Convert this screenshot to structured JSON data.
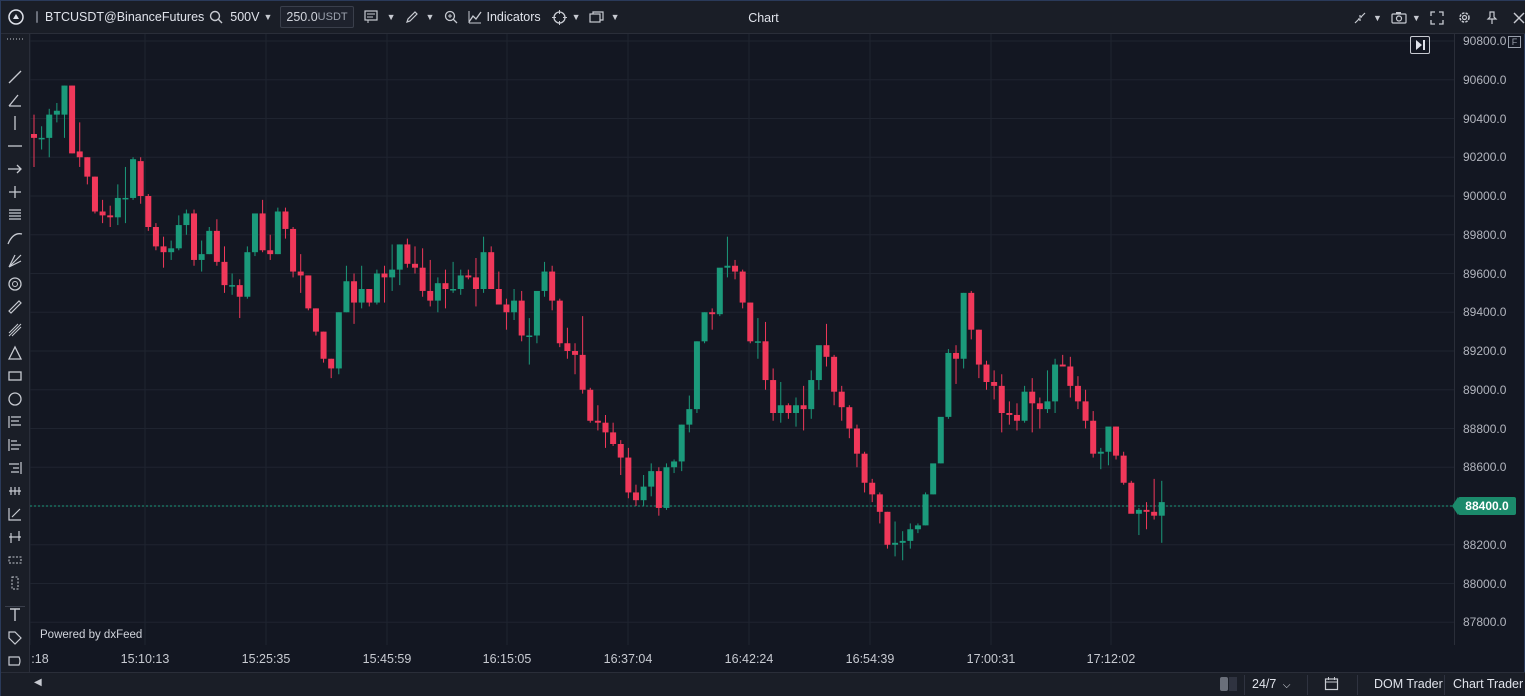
{
  "toolbar": {
    "symbol": "BTCUSDT@BinanceFutures",
    "timeframe": "500V",
    "quantity_value": "250.0",
    "quantity_unit": "USDT",
    "indicators_label": "Indicators"
  },
  "window": {
    "title": "Chart"
  },
  "price_axis": {
    "labels": [
      "90800.0",
      "90600.0",
      "90400.0",
      "90200.0",
      "90000.0",
      "89800.0",
      "89600.0",
      "89400.0",
      "89200.0",
      "89000.0",
      "88800.0",
      "88600.0",
      "88400.0",
      "88200.0",
      "88000.0",
      "87800.0"
    ],
    "current_price": "88400.0",
    "f_badge": "F"
  },
  "time_axis": {
    "labels": [
      ":18",
      "15:10:13",
      "15:25:35",
      "15:45:59",
      "16:15:05",
      "16:37:04",
      "16:42:24",
      "16:54:39",
      "17:00:31",
      "17:12:02"
    ]
  },
  "watermark": "Powered by dxFeed",
  "bottom": {
    "session": "24/7",
    "dom_trader": "DOM Trader",
    "chart_trader": "Chart Trader"
  },
  "colors": {
    "up": "#1b9a7b",
    "down": "#f0385a",
    "background": "#131722",
    "grid": "#1f2430"
  },
  "chart_data": {
    "type": "candlestick",
    "title": "",
    "ylim": [
      87700,
      90850
    ],
    "current_price": 88400,
    "x_tick_labels": [
      ":18",
      "15:10:13",
      "15:25:35",
      "15:45:59",
      "16:15:05",
      "16:37:04",
      "16:42:24",
      "16:54:39",
      "17:00:31",
      "17:12:02"
    ],
    "candles": [
      {
        "o": 90320,
        "h": 90420,
        "l": 90150,
        "c": 90300
      },
      {
        "o": 90300,
        "h": 90360,
        "l": 90240,
        "c": 90300
      },
      {
        "o": 90300,
        "h": 90450,
        "l": 90200,
        "c": 90420
      },
      {
        "o": 90420,
        "h": 90480,
        "l": 90380,
        "c": 90440
      },
      {
        "o": 90420,
        "h": 90570,
        "l": 90300,
        "c": 90570
      },
      {
        "o": 90570,
        "h": 90570,
        "l": 90220,
        "c": 90220
      },
      {
        "o": 90230,
        "h": 90380,
        "l": 90150,
        "c": 90200
      },
      {
        "o": 90200,
        "h": 90200,
        "l": 90060,
        "c": 90100
      },
      {
        "o": 90100,
        "h": 90100,
        "l": 89910,
        "c": 89920
      },
      {
        "o": 89920,
        "h": 89980,
        "l": 89860,
        "c": 89900
      },
      {
        "o": 89900,
        "h": 89950,
        "l": 89840,
        "c": 89890
      },
      {
        "o": 89890,
        "h": 90060,
        "l": 89850,
        "c": 89990
      },
      {
        "o": 89990,
        "h": 90150,
        "l": 89860,
        "c": 89990
      },
      {
        "o": 89990,
        "h": 90200,
        "l": 89980,
        "c": 90190
      },
      {
        "o": 90180,
        "h": 90200,
        "l": 89960,
        "c": 90000
      },
      {
        "o": 90000,
        "h": 90010,
        "l": 89820,
        "c": 89840
      },
      {
        "o": 89840,
        "h": 89860,
        "l": 89720,
        "c": 89740
      },
      {
        "o": 89740,
        "h": 89790,
        "l": 89630,
        "c": 89710
      },
      {
        "o": 89710,
        "h": 89770,
        "l": 89670,
        "c": 89730
      },
      {
        "o": 89730,
        "h": 89900,
        "l": 89720,
        "c": 89850
      },
      {
        "o": 89850,
        "h": 89930,
        "l": 89800,
        "c": 89910
      },
      {
        "o": 89910,
        "h": 89930,
        "l": 89640,
        "c": 89670
      },
      {
        "o": 89670,
        "h": 89770,
        "l": 89610,
        "c": 89700
      },
      {
        "o": 89700,
        "h": 89840,
        "l": 89700,
        "c": 89820
      },
      {
        "o": 89820,
        "h": 89880,
        "l": 89640,
        "c": 89660
      },
      {
        "o": 89660,
        "h": 89740,
        "l": 89500,
        "c": 89540
      },
      {
        "o": 89540,
        "h": 89600,
        "l": 89490,
        "c": 89540
      },
      {
        "o": 89540,
        "h": 89570,
        "l": 89370,
        "c": 89480
      },
      {
        "o": 89480,
        "h": 89740,
        "l": 89470,
        "c": 89710
      },
      {
        "o": 89710,
        "h": 89880,
        "l": 89690,
        "c": 89910
      },
      {
        "o": 89910,
        "h": 89980,
        "l": 89710,
        "c": 89720
      },
      {
        "o": 89720,
        "h": 89800,
        "l": 89670,
        "c": 89700
      },
      {
        "o": 89700,
        "h": 89940,
        "l": 89700,
        "c": 89920
      },
      {
        "o": 89920,
        "h": 89940,
        "l": 89780,
        "c": 89830
      },
      {
        "o": 89830,
        "h": 89840,
        "l": 89580,
        "c": 89610
      },
      {
        "o": 89610,
        "h": 89700,
        "l": 89500,
        "c": 89590
      },
      {
        "o": 89590,
        "h": 89590,
        "l": 89410,
        "c": 89420
      },
      {
        "o": 89420,
        "h": 89420,
        "l": 89280,
        "c": 89300
      },
      {
        "o": 89300,
        "h": 89300,
        "l": 89140,
        "c": 89160
      },
      {
        "o": 89160,
        "h": 89160,
        "l": 89060,
        "c": 89110
      },
      {
        "o": 89110,
        "h": 89400,
        "l": 89080,
        "c": 89400
      },
      {
        "o": 89400,
        "h": 89640,
        "l": 89400,
        "c": 89560
      },
      {
        "o": 89560,
        "h": 89600,
        "l": 89340,
        "c": 89450
      },
      {
        "o": 89450,
        "h": 89640,
        "l": 89420,
        "c": 89520
      },
      {
        "o": 89520,
        "h": 89520,
        "l": 89430,
        "c": 89450
      },
      {
        "o": 89450,
        "h": 89620,
        "l": 89440,
        "c": 89600
      },
      {
        "o": 89600,
        "h": 89640,
        "l": 89450,
        "c": 89580
      },
      {
        "o": 89580,
        "h": 89750,
        "l": 89510,
        "c": 89620
      },
      {
        "o": 89620,
        "h": 89750,
        "l": 89540,
        "c": 89750
      },
      {
        "o": 89750,
        "h": 89780,
        "l": 89630,
        "c": 89650
      },
      {
        "o": 89650,
        "h": 89740,
        "l": 89600,
        "c": 89630
      },
      {
        "o": 89630,
        "h": 89730,
        "l": 89480,
        "c": 89510
      },
      {
        "o": 89510,
        "h": 89670,
        "l": 89430,
        "c": 89460
      },
      {
        "o": 89460,
        "h": 89580,
        "l": 89400,
        "c": 89550
      },
      {
        "o": 89550,
        "h": 89620,
        "l": 89420,
        "c": 89520
      },
      {
        "o": 89520,
        "h": 89660,
        "l": 89500,
        "c": 89520
      },
      {
        "o": 89520,
        "h": 89620,
        "l": 89490,
        "c": 89590
      },
      {
        "o": 89590,
        "h": 89620,
        "l": 89570,
        "c": 89580
      },
      {
        "o": 89580,
        "h": 89680,
        "l": 89430,
        "c": 89520
      },
      {
        "o": 89520,
        "h": 89790,
        "l": 89500,
        "c": 89710
      },
      {
        "o": 89710,
        "h": 89740,
        "l": 89520,
        "c": 89520
      },
      {
        "o": 89520,
        "h": 89610,
        "l": 89440,
        "c": 89440
      },
      {
        "o": 89440,
        "h": 89470,
        "l": 89310,
        "c": 89400
      },
      {
        "o": 89400,
        "h": 89520,
        "l": 89360,
        "c": 89460
      },
      {
        "o": 89460,
        "h": 89510,
        "l": 89250,
        "c": 89280
      },
      {
        "o": 89280,
        "h": 89370,
        "l": 89130,
        "c": 89280
      },
      {
        "o": 89280,
        "h": 89430,
        "l": 89240,
        "c": 89510
      },
      {
        "o": 89510,
        "h": 89660,
        "l": 89480,
        "c": 89610
      },
      {
        "o": 89610,
        "h": 89640,
        "l": 89410,
        "c": 89460
      },
      {
        "o": 89460,
        "h": 89470,
        "l": 89220,
        "c": 89240
      },
      {
        "o": 89240,
        "h": 89320,
        "l": 89160,
        "c": 89200
      },
      {
        "o": 89200,
        "h": 89240,
        "l": 89080,
        "c": 89180
      },
      {
        "o": 89180,
        "h": 89380,
        "l": 88980,
        "c": 89000
      },
      {
        "o": 89000,
        "h": 89010,
        "l": 88830,
        "c": 88840
      },
      {
        "o": 88840,
        "h": 88920,
        "l": 88790,
        "c": 88830
      },
      {
        "o": 88830,
        "h": 88870,
        "l": 88700,
        "c": 88780
      },
      {
        "o": 88780,
        "h": 88830,
        "l": 88710,
        "c": 88720
      },
      {
        "o": 88720,
        "h": 88740,
        "l": 88560,
        "c": 88650
      },
      {
        "o": 88650,
        "h": 88700,
        "l": 88440,
        "c": 88470
      },
      {
        "o": 88470,
        "h": 88510,
        "l": 88400,
        "c": 88430
      },
      {
        "o": 88430,
        "h": 88560,
        "l": 88400,
        "c": 88500
      },
      {
        "o": 88500,
        "h": 88620,
        "l": 88450,
        "c": 88580
      },
      {
        "o": 88580,
        "h": 88600,
        "l": 88350,
        "c": 88390
      },
      {
        "o": 88390,
        "h": 88620,
        "l": 88380,
        "c": 88600
      },
      {
        "o": 88600,
        "h": 88640,
        "l": 88570,
        "c": 88630
      },
      {
        "o": 88630,
        "h": 88820,
        "l": 88580,
        "c": 88820
      },
      {
        "o": 88820,
        "h": 88970,
        "l": 88780,
        "c": 88900
      },
      {
        "o": 88900,
        "h": 89250,
        "l": 88880,
        "c": 89250
      },
      {
        "o": 89250,
        "h": 89400,
        "l": 89240,
        "c": 89400
      },
      {
        "o": 89400,
        "h": 89420,
        "l": 89310,
        "c": 89390
      },
      {
        "o": 89390,
        "h": 89620,
        "l": 89380,
        "c": 89630
      },
      {
        "o": 89630,
        "h": 89790,
        "l": 89580,
        "c": 89640
      },
      {
        "o": 89640,
        "h": 89670,
        "l": 89570,
        "c": 89610
      },
      {
        "o": 89610,
        "h": 89620,
        "l": 89420,
        "c": 89450
      },
      {
        "o": 89450,
        "h": 89450,
        "l": 89240,
        "c": 89250
      },
      {
        "o": 89250,
        "h": 89370,
        "l": 89160,
        "c": 89250
      },
      {
        "o": 89250,
        "h": 89350,
        "l": 89000,
        "c": 89050
      },
      {
        "o": 89050,
        "h": 89110,
        "l": 88840,
        "c": 88880
      },
      {
        "o": 88880,
        "h": 89040,
        "l": 88830,
        "c": 88920
      },
      {
        "o": 88920,
        "h": 88930,
        "l": 88850,
        "c": 88880
      },
      {
        "o": 88880,
        "h": 88960,
        "l": 88810,
        "c": 88920
      },
      {
        "o": 88920,
        "h": 89020,
        "l": 88790,
        "c": 88900
      },
      {
        "o": 88900,
        "h": 89100,
        "l": 88850,
        "c": 89050
      },
      {
        "o": 89050,
        "h": 89180,
        "l": 89000,
        "c": 89230
      },
      {
        "o": 89230,
        "h": 89340,
        "l": 89120,
        "c": 89170
      },
      {
        "o": 89170,
        "h": 89180,
        "l": 88920,
        "c": 88990
      },
      {
        "o": 88990,
        "h": 89020,
        "l": 88840,
        "c": 88910
      },
      {
        "o": 88910,
        "h": 88920,
        "l": 88750,
        "c": 88800
      },
      {
        "o": 88800,
        "h": 88820,
        "l": 88600,
        "c": 88670
      },
      {
        "o": 88670,
        "h": 88680,
        "l": 88470,
        "c": 88520
      },
      {
        "o": 88520,
        "h": 88540,
        "l": 88420,
        "c": 88460
      },
      {
        "o": 88460,
        "h": 88470,
        "l": 88310,
        "c": 88370
      },
      {
        "o": 88370,
        "h": 88370,
        "l": 88180,
        "c": 88200
      },
      {
        "o": 88200,
        "h": 88320,
        "l": 88140,
        "c": 88210
      },
      {
        "o": 88210,
        "h": 88270,
        "l": 88120,
        "c": 88220
      },
      {
        "o": 88220,
        "h": 88310,
        "l": 88180,
        "c": 88280
      },
      {
        "o": 88280,
        "h": 88310,
        "l": 88260,
        "c": 88300
      },
      {
        "o": 88300,
        "h": 88470,
        "l": 88300,
        "c": 88460
      },
      {
        "o": 88460,
        "h": 88600,
        "l": 88460,
        "c": 88620
      },
      {
        "o": 88620,
        "h": 88850,
        "l": 88620,
        "c": 88860
      },
      {
        "o": 88860,
        "h": 89210,
        "l": 88850,
        "c": 89190
      },
      {
        "o": 89190,
        "h": 89230,
        "l": 89030,
        "c": 89160
      },
      {
        "o": 89160,
        "h": 89500,
        "l": 89110,
        "c": 89500
      },
      {
        "o": 89500,
        "h": 89510,
        "l": 89260,
        "c": 89310
      },
      {
        "o": 89310,
        "h": 89310,
        "l": 89060,
        "c": 89130
      },
      {
        "o": 89130,
        "h": 89150,
        "l": 89000,
        "c": 89040
      },
      {
        "o": 89040,
        "h": 89100,
        "l": 88950,
        "c": 89020
      },
      {
        "o": 89020,
        "h": 89080,
        "l": 88780,
        "c": 88880
      },
      {
        "o": 88880,
        "h": 88940,
        "l": 88820,
        "c": 88870
      },
      {
        "o": 88870,
        "h": 88930,
        "l": 88790,
        "c": 88840
      },
      {
        "o": 88840,
        "h": 89020,
        "l": 88830,
        "c": 88990
      },
      {
        "o": 88990,
        "h": 89060,
        "l": 88780,
        "c": 88930
      },
      {
        "o": 88930,
        "h": 88960,
        "l": 88800,
        "c": 88900
      },
      {
        "o": 88900,
        "h": 89100,
        "l": 88880,
        "c": 88940
      },
      {
        "o": 88940,
        "h": 89160,
        "l": 88880,
        "c": 89130
      },
      {
        "o": 89130,
        "h": 89180,
        "l": 89120,
        "c": 89120
      },
      {
        "o": 89120,
        "h": 89170,
        "l": 88960,
        "c": 89020
      },
      {
        "o": 89020,
        "h": 89070,
        "l": 88900,
        "c": 88940
      },
      {
        "o": 88940,
        "h": 89000,
        "l": 88800,
        "c": 88840
      },
      {
        "o": 88840,
        "h": 88890,
        "l": 88650,
        "c": 88670
      },
      {
        "o": 88670,
        "h": 88700,
        "l": 88590,
        "c": 88680
      },
      {
        "o": 88680,
        "h": 88800,
        "l": 88610,
        "c": 88810
      },
      {
        "o": 88810,
        "h": 88810,
        "l": 88640,
        "c": 88660
      },
      {
        "o": 88660,
        "h": 88680,
        "l": 88510,
        "c": 88520
      },
      {
        "o": 88520,
        "h": 88530,
        "l": 88390,
        "c": 88360
      },
      {
        "o": 88360,
        "h": 88390,
        "l": 88250,
        "c": 88380
      },
      {
        "o": 88380,
        "h": 88420,
        "l": 88280,
        "c": 88370
      },
      {
        "o": 88370,
        "h": 88540,
        "l": 88330,
        "c": 88350
      },
      {
        "o": 88350,
        "h": 88530,
        "l": 88210,
        "c": 88420
      }
    ]
  }
}
